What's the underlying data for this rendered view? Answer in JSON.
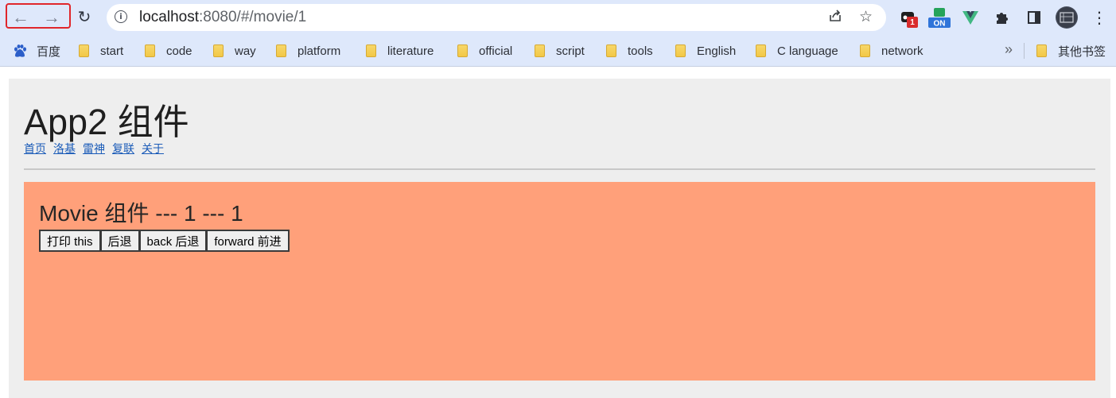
{
  "browser": {
    "url_host": "localhost",
    "url_rest": ":8080/#/movie/1",
    "icons": {
      "back": "arrow-left-icon",
      "forward": "arrow-right-icon",
      "reload": "reload-icon",
      "info": "info-icon",
      "share": "share-icon",
      "star": "bookmark-star-icon",
      "extensions": "puzzle-icon",
      "sidepanel": "side-panel-icon",
      "menu": "kebab-menu-icon"
    },
    "extension_badge": "1",
    "extension_on_label": "ON"
  },
  "bookmarks": {
    "items": [
      {
        "label": "百度",
        "icon": "baidu-paw-icon"
      },
      {
        "label": "start",
        "icon": "folder-icon"
      },
      {
        "label": "code",
        "icon": "folder-icon"
      },
      {
        "label": "way",
        "icon": "folder-icon"
      },
      {
        "label": "platform",
        "icon": "folder-icon"
      },
      {
        "label": "literature",
        "icon": "folder-icon"
      },
      {
        "label": "official",
        "icon": "folder-icon"
      },
      {
        "label": "script",
        "icon": "folder-icon"
      },
      {
        "label": "tools",
        "icon": "folder-icon"
      },
      {
        "label": "English",
        "icon": "folder-icon"
      },
      {
        "label": "C language",
        "icon": "folder-icon"
      },
      {
        "label": "network",
        "icon": "folder-icon"
      }
    ],
    "overflow": "»",
    "other": "其他书签"
  },
  "app": {
    "title": "App2 组件",
    "nav": [
      "首页",
      "洛基",
      "雷神",
      "复联",
      "关于"
    ]
  },
  "movie": {
    "title": "Movie 组件 --- 1 --- 1",
    "buttons": [
      "打印 this",
      "后退",
      "back 后退",
      "forward 前进"
    ],
    "background": "#ffa07a"
  },
  "colors": {
    "toolbar": "#dee8fb",
    "page_bg": "#eeeeee",
    "link": "#1a5bb8",
    "highlight": "#e0262b"
  }
}
